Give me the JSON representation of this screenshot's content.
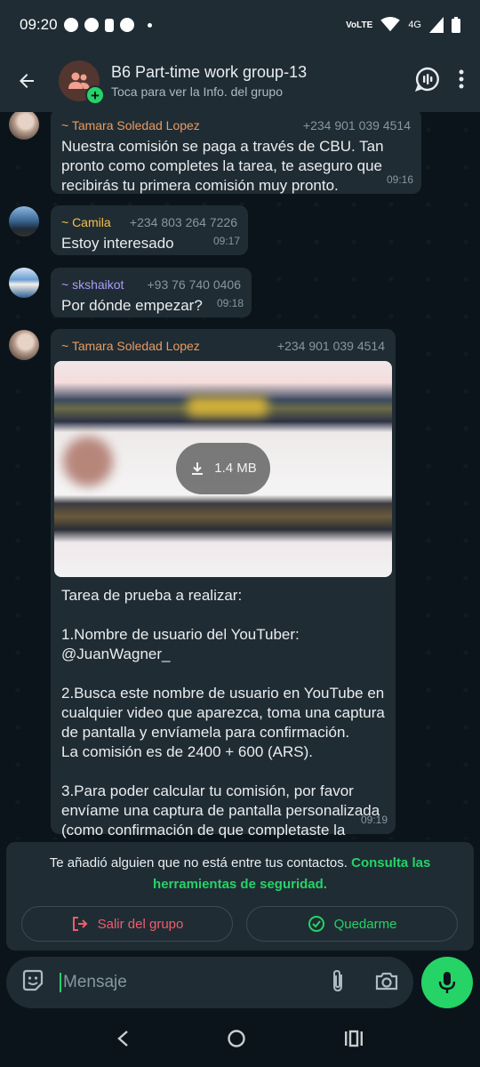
{
  "status_bar": {
    "time": "09:20",
    "network": "4G"
  },
  "header": {
    "title": "B6 Part-time work group-13",
    "subtitle": "Toca para ver la Info. del grupo"
  },
  "messages": [
    {
      "sender": "~ Tamara Soledad Lopez",
      "phone": "+234 901 039 4514",
      "text": "Nuestra comisión se paga a través de CBU. Tan pronto como completes la tarea, te aseguro que recibirás tu primera comisión muy pronto.",
      "time": "09:16",
      "sender_color": "#e79b65"
    },
    {
      "sender": "~ Camila",
      "phone": "+234 803 264 7226",
      "text": "Estoy interesado",
      "time": "09:17",
      "sender_color": "#f6c04b"
    },
    {
      "sender": "~ skshaikot",
      "phone": "+93 76 740 0406",
      "text": "Por dónde empezar?",
      "time": "09:18",
      "sender_color": "#a89df5"
    },
    {
      "sender": "~ Tamara Soledad Lopez",
      "phone": "+234 901 039 4514",
      "image_size": "1.4 MB",
      "text": "Tarea de prueba a realizar:\n\n1.Nombre de usuario del YouTuber:\n@JuanWagner_\n\n2.Busca este nombre de usuario en YouTube en cualquier video que aparezca, toma una captura de pantalla y envíamela para confirmación.\nLa comisión es de 2400 + 600 (ARS).\n\n3.Para poder calcular tu comisión, por favor envíame una captura de pantalla personalizada (como confirmación de que completaste la tarea).",
      "time": "09:19",
      "sender_color": "#e79b65"
    }
  ],
  "security_notice": {
    "text": "Te añadió alguien que no está entre tus contactos.",
    "link": "Consulta las herramientas de seguridad.",
    "leave_label": "Salir del grupo",
    "stay_label": "Quedarme"
  },
  "composer": {
    "placeholder": "Mensaje"
  },
  "colors": {
    "accent": "#25d366",
    "danger": "#f15c6d",
    "bubble": "#202c33",
    "bar": "#1f2c34"
  },
  "icons": [
    "facebook-icon",
    "tinder-like-icon",
    "battery-icon",
    "soccer-icon",
    "volte-icon",
    "wifi-icon",
    "signal-icon",
    "back-arrow-icon",
    "group-icon",
    "voice-chat-icon",
    "more-vert-icon",
    "download-icon",
    "exit-icon",
    "check-circle-icon",
    "sticker-icon",
    "attach-icon",
    "camera-icon",
    "mic-icon"
  ]
}
